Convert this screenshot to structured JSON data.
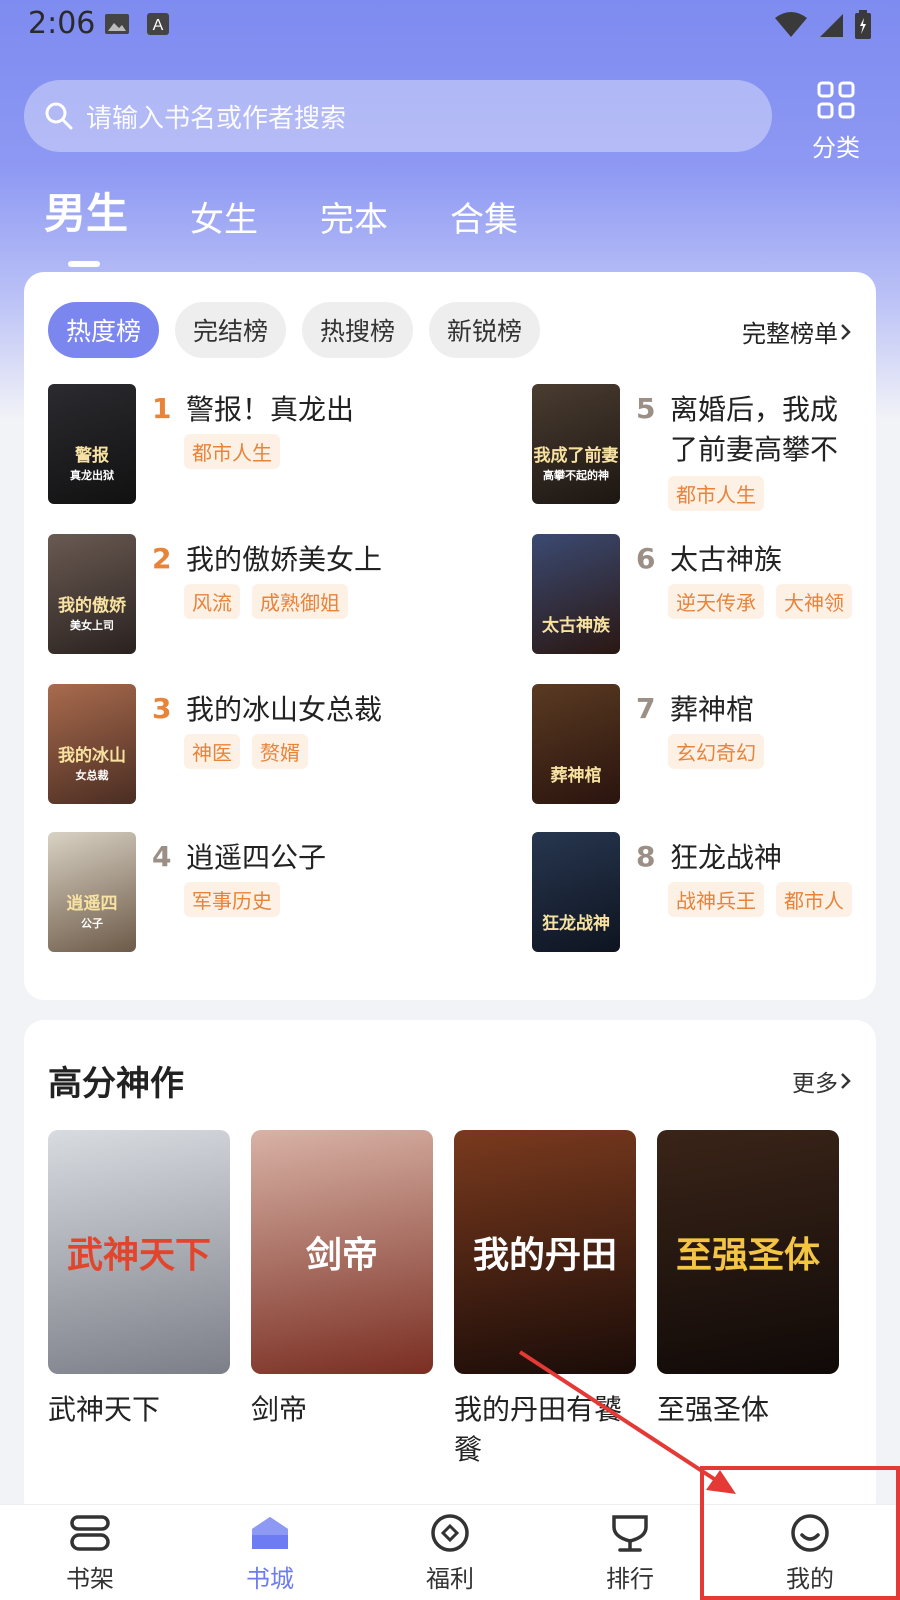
{
  "status": {
    "time": "2:06"
  },
  "search": {
    "placeholder": "请输入书名或作者搜索"
  },
  "category": {
    "label": "分类"
  },
  "gender_tabs": [
    "男生",
    "女生",
    "完本",
    "合集"
  ],
  "rank": {
    "chips": [
      "热度榜",
      "完结榜",
      "热搜榜",
      "新锐榜"
    ],
    "full_list_label": "完整榜单",
    "items": [
      {
        "num": "1",
        "title": "警报！真龙出狱！",
        "tags": [
          "都市人生"
        ],
        "cover_text": "警报",
        "cover_sub": "真龙出狱",
        "colors": [
          "#2b2b30",
          "#111"
        ],
        "num_color": "#e8833a"
      },
      {
        "num": "2",
        "title": "我的傲娇美女上司",
        "tags": [
          "风流",
          "成熟御姐"
        ],
        "cover_text": "我的傲娇",
        "cover_sub": "美女上司",
        "colors": [
          "#6a5a52",
          "#2a2220"
        ],
        "num_color": "#e8833a"
      },
      {
        "num": "3",
        "title": "我的冰山女总裁",
        "tags": [
          "神医",
          "赘婿"
        ],
        "cover_text": "我的冰山",
        "cover_sub": "女总裁",
        "colors": [
          "#a96b4e",
          "#4a2d22"
        ],
        "num_color": "#e8833a"
      },
      {
        "num": "4",
        "title": "逍遥四公子",
        "tags": [
          "军事历史"
        ],
        "cover_text": "逍遥四",
        "cover_sub": "公子",
        "colors": [
          "#d9d2c4",
          "#6d5a48"
        ],
        "num_color": "#9b8f86"
      },
      {
        "num": "5",
        "title": "离婚后，我成了前妻高攀不起的神",
        "tags": [
          "都市人生"
        ],
        "cover_text": "我成了前妻",
        "cover_sub": "高攀不起的神",
        "colors": [
          "#4a3c30",
          "#1c1612"
        ],
        "num_color": "#9b8f86"
      },
      {
        "num": "6",
        "title": "太古神族",
        "tags": [
          "逆天传承",
          "大神领"
        ],
        "cover_text": "太古神族",
        "cover_sub": "",
        "colors": [
          "#3b4a72",
          "#2a1712"
        ],
        "num_color": "#9b8f86"
      },
      {
        "num": "7",
        "title": "葬神棺",
        "tags": [
          "玄幻奇幻"
        ],
        "cover_text": "葬神棺",
        "cover_sub": "",
        "colors": [
          "#5a3a22",
          "#2a140e"
        ],
        "num_color": "#9b8f86"
      },
      {
        "num": "8",
        "title": "狂龙战神",
        "tags": [
          "战神兵王",
          "都市人"
        ],
        "cover_text": "狂龙战神",
        "cover_sub": "",
        "colors": [
          "#27364f",
          "#0e1420"
        ],
        "num_color": "#9b8f86"
      }
    ]
  },
  "high_score": {
    "title": "高分神作",
    "more_label": "更多",
    "books": [
      {
        "title": "武神天下",
        "cover_text": "武神天下",
        "colors": [
          "#d8dbe0",
          "#7c7f88"
        ],
        "text_color": "#e2452b"
      },
      {
        "title": "剑帝",
        "cover_text": "剑帝",
        "colors": [
          "#d9b2a6",
          "#7a2e22"
        ],
        "text_color": "#ffffff"
      },
      {
        "title": "我的丹田有饕餮",
        "cover_text": "我的丹田",
        "colors": [
          "#7a3a1e",
          "#1a0c08"
        ],
        "text_color": "#ffffff"
      },
      {
        "title": "至强圣体",
        "cover_text": "至强圣体",
        "colors": [
          "#3a2418",
          "#100a08"
        ],
        "text_color": "#f4c542"
      }
    ]
  },
  "bottom_nav": [
    {
      "label": "书架",
      "icon": "bookshelf-icon",
      "active": false
    },
    {
      "label": "书城",
      "icon": "home-icon",
      "active": true
    },
    {
      "label": "福利",
      "icon": "welfare-icon",
      "active": false
    },
    {
      "label": "排行",
      "icon": "trophy-icon",
      "active": false
    },
    {
      "label": "我的",
      "icon": "profile-icon",
      "active": false
    }
  ],
  "colors": {
    "accent": "#7b86ef",
    "tag_bg": "#fdf1e6",
    "tag_text": "#e8833a",
    "annotation": "#e53935"
  }
}
